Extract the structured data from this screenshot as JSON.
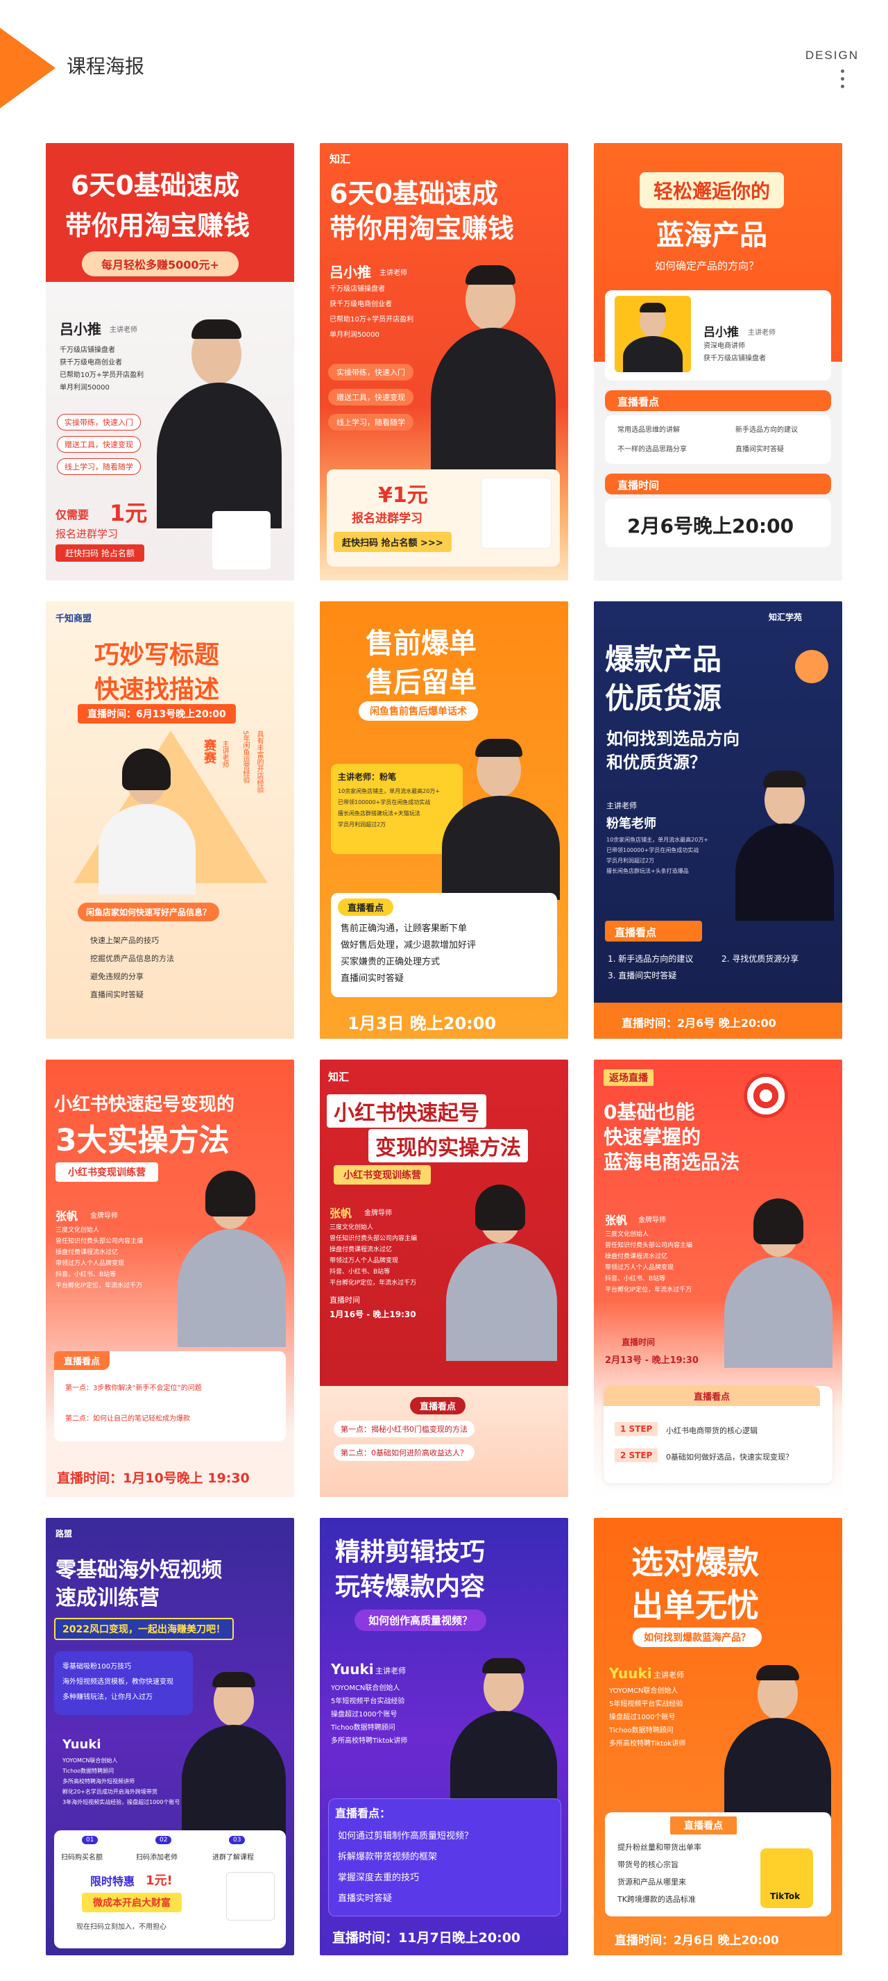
{
  "header": {
    "title": "课程海报",
    "design": "DESIGN"
  },
  "c1": {
    "t1": "6天0基础速成",
    "t2": "带你用淘宝赚钱",
    "sub": "每月轻松多赚5000元+",
    "name": "吕小推",
    "role": "主讲老师",
    "bullets": [
      "千万级店铺操盘者",
      "获千万级电商创业者",
      "已帮助10万+学员开店盈利",
      "单月利润50000"
    ],
    "tags": [
      "实操带练，快速入门",
      "赠送工具，快速变现",
      "线上学习，随看随学"
    ],
    "price_pre": "仅需要",
    "price": "1元",
    "signup": "报名进群学习",
    "cta": "赶快扫码  抢占名额"
  },
  "c2": {
    "logo": "知汇",
    "t1": "6天0基础速成",
    "t2": "带你用淘宝赚钱",
    "name": "吕小推",
    "role": "主讲老师",
    "bullets": [
      "千万级店铺操盘者",
      "获千万级电商创业者",
      "已帮助10万+学员开店盈利",
      "单月利润50000"
    ],
    "tags": [
      "实操带练，快速入门",
      "赠送工具，快速变现",
      "线上学习，随看随学"
    ],
    "price": "¥1元",
    "signup": "报名进群学习",
    "cta": "赶快扫码  抢占名额 >>>"
  },
  "c3": {
    "t1": "轻松邂逅你的",
    "t2": "蓝海产品",
    "sub": "如何确定产品的方向？",
    "name": "吕小推",
    "role": "主讲老师",
    "bullets": [
      "资深电商讲师",
      "获千万级店铺操盘者"
    ],
    "sec1": "直播看点",
    "points": [
      "常用选品思维的讲解",
      "新手选品方向的建议",
      "不一样的选品思路分享",
      "直播间实时答疑"
    ],
    "sec2": "直播时间",
    "time": "2月6号晚上20:00"
  },
  "c4": {
    "logo": "千知商盟",
    "t1": "巧妙写标题",
    "t2": "快速找描述",
    "time": "直播时间：6月13号晚上20:00",
    "name": "赛赛",
    "role": "主讲老师",
    "desc1": "5年闲鱼运营经验",
    "desc2": "具有丰富的开店经验",
    "question": "闲鱼店家如何快速写好产品信息？",
    "points": [
      "快速上架产品的技巧",
      "挖掘优质产品信息的方法",
      "避免违规的分享",
      "直播间实时答疑"
    ]
  },
  "c5": {
    "t1": "售前爆单",
    "t2": "售后留单",
    "sub": "闲鱼售前售后爆单话术",
    "name": "主讲老师：粉笔",
    "bullets": [
      "10余家闲鱼店铺主，单月流水最高20万+",
      "已带领100000+学员在闲鱼成功实战",
      "擅长闲鱼店群搭建玩法+天猫玩法",
      "学员月利润超过2万"
    ],
    "sec": "直播看点",
    "points": [
      "售前正确沟通，让顾客果断下单",
      "做好售后处理，减少退款增加好评",
      "买家嫌贵的正确处理方式",
      "直播间实时答疑"
    ],
    "time": "1月3日 晚上20:00"
  },
  "c6": {
    "logo": "知汇学苑",
    "t1": "爆款产品",
    "t2": "优质货源",
    "q1": "如何找到选品方向",
    "q2": "和优质货源？",
    "role": "主讲老师",
    "name": "粉笔老师",
    "bullets": [
      "10余家闲鱼店铺主，单月流水最高20万+",
      "已带领100000+学员在闲鱼成功实战",
      "学员月利润超过2万",
      "擅长闲鱼店群玩法+头条打造爆品"
    ],
    "sec": "直播看点",
    "points": [
      "1. 新手选品方向的建议",
      "2. 寻找优质货源分享",
      "3. 直播间实时答疑"
    ],
    "time": "直播时间：2月6号 晚上20:00"
  },
  "c7": {
    "t1": "小红书快速起号变现的",
    "t2": "3大实操方法",
    "sub": "小红书变现训练营",
    "name": "张帆",
    "role": "金牌导师",
    "bullets": [
      "三度文化创始人",
      "曾任知识付费头部公司内容主编",
      "操盘付费课程流水过亿",
      "带领过万人个人品牌变现",
      "抖音、小红书、B站等",
      "平台孵化IP定位，年流水过千万"
    ],
    "sec": "直播看点",
    "points": [
      "第一点：3步教你解决“新手不会定位”的问题",
      "第二点：如何让自己的笔记轻松成为爆款"
    ],
    "time": "直播时间：1月10号晚上 19:30"
  },
  "c8": {
    "logo": "知汇",
    "t1": "小红书快速起号",
    "t2": "变现的实操方法",
    "sub": "小红书变现训练营",
    "name": "张帆",
    "role": "金牌导师",
    "bullets": [
      "三度文化创始人",
      "曾任知识付费头部公司内容主编",
      "操盘付费课程流水过亿",
      "带领过万人个人品牌变现",
      "抖音、小红书、B站等",
      "平台孵化IP定位，年流水过千万"
    ],
    "tlabel": "直播时间",
    "time": "1月16号 - 晚上19:30",
    "sec": "直播看点",
    "points": [
      "第一点：揭秘小红书0门槛变现的方法",
      "第二点：0基础如何进阶高收益达人？"
    ]
  },
  "c9": {
    "badge": "返场直播",
    "t1": "0基础也能",
    "t2": "快速掌握的",
    "t3": "蓝海电商选品法",
    "name": "张帆",
    "role": "金牌导师",
    "bullets": [
      "三度文化创始人",
      "曾任知识付费头部公司内容主编",
      "操盘付费课程流水过亿",
      "带领过万人个人品牌变现",
      "抖音、小红书、B站等",
      "平台孵化IP定位，年流水过千万"
    ],
    "tlabel": "直播时间",
    "time": "2月13号 - 晚上19:30",
    "sec": "直播看点",
    "steps": [
      {
        "s": "1 STEP",
        "p": "小红书电商带货的核心逻辑"
      },
      {
        "s": "2 STEP",
        "p": "0基础如何做好选品，快速实现变现？"
      }
    ]
  },
  "c10": {
    "logo": "路盟",
    "t1": "零基础海外短视频",
    "t2": "速成训练营",
    "banner": "2022风口变现，一起出海赚美刀吧！",
    "points": [
      "零基础吸粉100万技巧",
      "海外短视频选货模板，教你快速变现",
      "多种赚钱玩法，让你月入过万"
    ],
    "name": "Yuuki",
    "bullets": [
      "YOYOMCN联合创始人",
      "Tichoo数据特聘顾问",
      "多所高校特聘海外短视频讲师",
      "孵化20+名学员成功开启海外跨境带货",
      "3年海外短视频实战经验，操盘超过1000个账号"
    ],
    "steps": [
      "扫码购买名额",
      "扫码添加老师",
      "进群了解课程"
    ],
    "nums": [
      "01",
      "02",
      "03"
    ],
    "price_pre": "限时特惠",
    "price": "1元!",
    "cta": "微成本开启大财富",
    "foot": "现在扫码立刻加入，不用担心"
  },
  "c11": {
    "t1": "精耕剪辑技巧",
    "t2": "玩转爆款内容",
    "sub": "如何创作高质量视频？",
    "name": "Yuuki",
    "role": "主讲老师",
    "bullets": [
      "YOYOMCN联合创始人",
      "5年短视频平台实战经验",
      "操盘超过1000个账号",
      "Tichoo数据特聘顾问",
      "多所高校特聘Tiktok讲师"
    ],
    "sec": "直播看点：",
    "points": [
      "如何通过剪辑制作高质量短视频？",
      "拆解爆款带货视频的框架",
      "掌握深度去重的技巧",
      "直播实时答疑"
    ],
    "time": "直播时间：11月7日晚上20:00"
  },
  "c12": {
    "t1": "选对爆款",
    "t2": "出单无忧",
    "sub": "如何找到爆款蓝海产品？",
    "name": "Yuuki",
    "role": "主讲老师",
    "bullets": [
      "YOYOMCN联合创始人",
      "5年短视频平台实战经验",
      "操盘超过1000个账号",
      "Tichoo数据特聘顾问",
      "多所高校特聘Tiktok讲师"
    ],
    "sec": "直播看点",
    "points": [
      "提升粉丝量和带货出单率",
      "带货号的核心宗旨",
      "货源和产品从哪里来",
      "TK跨境爆款的选品标准"
    ],
    "tiktok": "TikTok",
    "time": "直播时间：2月6日 晚上20:00"
  }
}
